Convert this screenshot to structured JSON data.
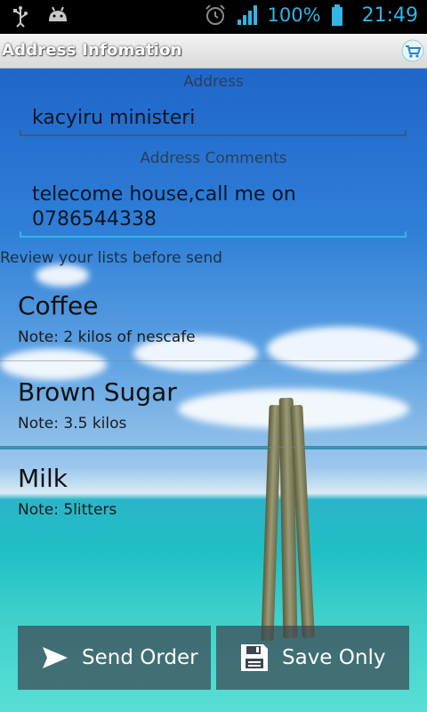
{
  "status": {
    "battery": "100%",
    "time": "21:49"
  },
  "actionbar": {
    "title": "Address Infomation"
  },
  "form": {
    "address_label": "Address",
    "address_value": "kacyiru ministeri",
    "comments_label": "Address Comments",
    "comments_line1": "telecome house,call me on",
    "comments_line2": "0786544338"
  },
  "review_label": "Review your lists before send",
  "items": [
    {
      "name": "Coffee",
      "note": "Note: 2 kilos of nescafe"
    },
    {
      "name": "Brown Sugar",
      "note": "Note: 3.5 kilos"
    },
    {
      "name": "Milk",
      "note": "Note: 5litters"
    }
  ],
  "buttons": {
    "send": "Send Order",
    "save": "Save Only"
  },
  "colors": {
    "holo_blue": "#33b5e5",
    "button_bg": "#3c4650"
  },
  "icons": [
    "usb-icon",
    "android-icon",
    "alarm-icon",
    "signal-icon",
    "battery-icon",
    "cart-icon",
    "send-icon",
    "save-icon"
  ]
}
